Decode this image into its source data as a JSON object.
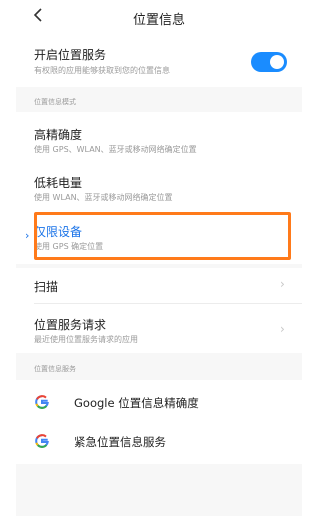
{
  "header": {
    "title": "位置信息",
    "back_icon": "back-chevron-icon"
  },
  "location_service": {
    "title": "开启位置服务",
    "subtitle": "有权限的应用能够获取到您的位置信息",
    "enabled": true
  },
  "mode_section": {
    "label": "位置信息模式",
    "options": [
      {
        "title": "高精确度",
        "subtitle": "使用 GPS、WLAN、蓝牙或移动网络确定位置",
        "selected": false
      },
      {
        "title": "低耗电量",
        "subtitle": "使用 WLAN、蓝牙或移动网络确定位置",
        "selected": false
      },
      {
        "title": "仅限设备",
        "subtitle": "使用 GPS 确定位置",
        "selected": true
      }
    ]
  },
  "scan": {
    "title": "扫描"
  },
  "requests": {
    "title": "位置服务请求",
    "subtitle": "最近使用位置服务请求的应用"
  },
  "services_section": {
    "label": "位置信息服务",
    "items": [
      {
        "icon": "google-icon",
        "label": "Google 位置信息精确度"
      },
      {
        "icon": "google-icon",
        "label": "紧急位置信息服务"
      }
    ]
  },
  "colors": {
    "accent": "#1a8cff",
    "highlight": "#ff7a1a",
    "selected_text": "#1a73e8"
  }
}
